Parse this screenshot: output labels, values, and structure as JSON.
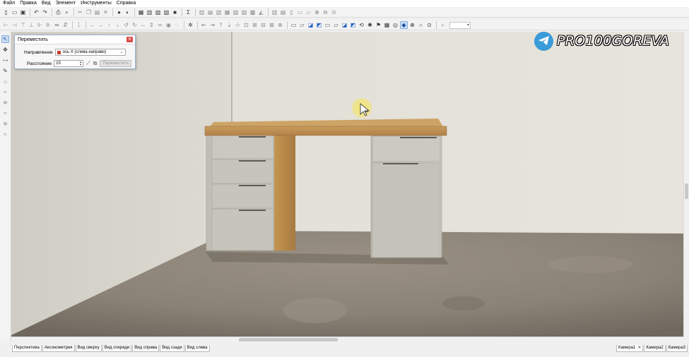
{
  "menu": [
    "Файл",
    "Правка",
    "Вид",
    "Элемент",
    "Инструменты",
    "Справка"
  ],
  "toolbar_icons": {
    "row1": [
      "new-file-icon",
      "open-folder-icon",
      "save-icon",
      "undo-icon",
      "redo-icon",
      "print-icon",
      "print-preview-icon",
      "cut-icon",
      "copy-icon",
      "paste-icon",
      "delete-icon",
      "render-sphere-icon",
      "material-icon",
      "properties-icon",
      "wall-icon",
      "door-icon",
      "window-icon",
      "stop-icon",
      "sum-icon"
    ],
    "row2": [
      "grid-icon",
      "align-left-icon",
      "align-right-icon",
      "align-top-icon",
      "align-bottom-icon",
      "view-front-icon",
      "view-top-icon",
      "view-right-icon",
      "view-left-icon",
      "view-back-icon",
      "view-persp-icon",
      "view-iso-icon",
      "rotate-icon",
      "light-icon",
      "eye-icon",
      "grid-view-icon",
      "snap-icon",
      "camera-icon",
      "render-icon"
    ]
  },
  "dialog": {
    "title": "Переместить",
    "direction_label": "Направление",
    "direction_value": "ось X (слева направо)",
    "direction_color": "#c73a2e",
    "distance_label": "Расстояние",
    "distance_value": "15",
    "move_button": "Переместить"
  },
  "watermark": {
    "text": "PRO100GOREVA",
    "icon": "telegram-icon"
  },
  "view_tabs": [
    "Перспектива",
    "Аксонометрия",
    "Вид сверху",
    "Вид спереди",
    "Вид справа",
    "Вид сзади",
    "Вид слева"
  ],
  "camera_tabs": [
    "Камера1",
    "Камера2",
    "Камера3"
  ],
  "colors": {
    "accent": "#3a9bd9",
    "dialog_border": "#9cb2d3",
    "close_button": "#d9504a",
    "tabletop": "#b8884f",
    "cabinet": "#c9c7be",
    "wall": "#e2e0d7",
    "floor": "#8f877a"
  }
}
